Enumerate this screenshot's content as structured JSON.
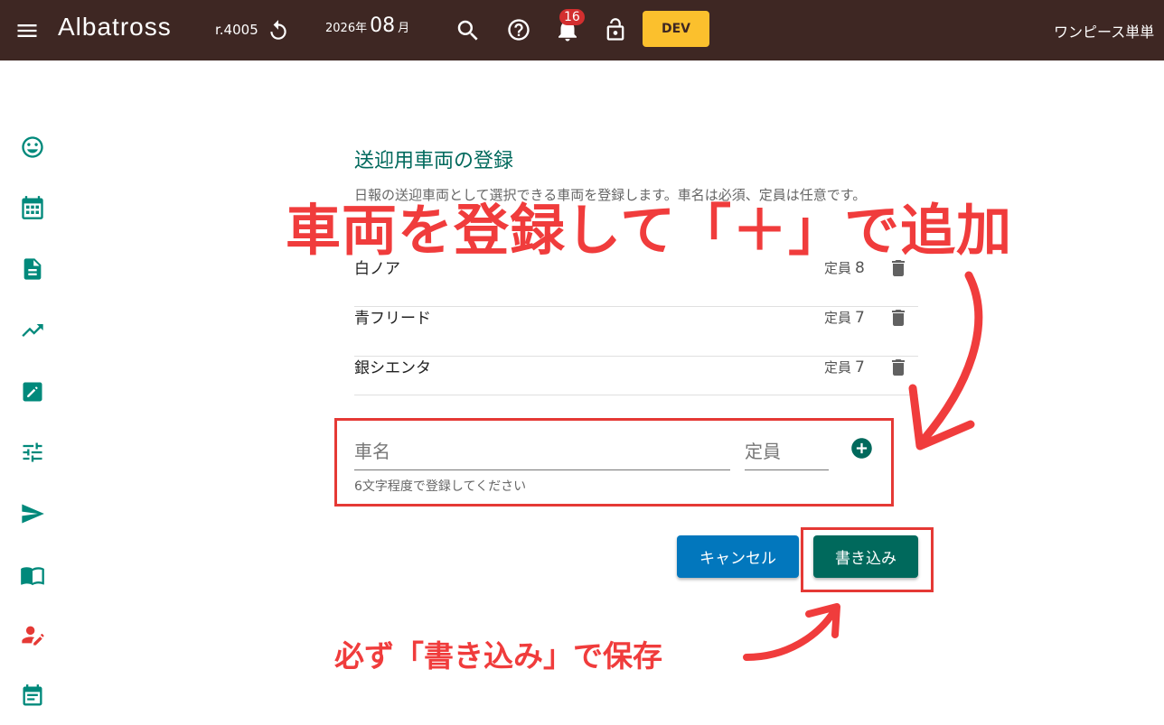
{
  "header": {
    "logo": "Albatross",
    "revision": "r.4005",
    "year": "2026年",
    "month": "08",
    "month_unit": "月",
    "notification_count": "16",
    "env_label": "DEV",
    "user_name": "ワンピース単単"
  },
  "page": {
    "title": "送迎用車両の登録",
    "description": "日報の送迎車両として選択できる車両を登録します。車名は必須、定員は任意です。"
  },
  "vehicles": [
    {
      "name": "白ノア",
      "capacity_label": "定員",
      "capacity": "8"
    },
    {
      "name": "青フリード",
      "capacity_label": "定員",
      "capacity": "7"
    },
    {
      "name": "銀シエンタ",
      "capacity_label": "定員",
      "capacity": "7"
    }
  ],
  "form": {
    "name_placeholder": "車名",
    "capacity_placeholder": "定員",
    "name_hint": "6文字程度で登録してください"
  },
  "actions": {
    "cancel_label": "キャンセル",
    "save_label": "書き込み"
  },
  "annotations": {
    "main": "車両を登録して「＋」で追加",
    "save_note": "必ず「書き込み」で保存"
  },
  "colors": {
    "header_bg": "#3e2723",
    "accent": "#00695c",
    "cancel": "#0277bd",
    "dev": "#fbc02d",
    "annotation": "#f03c3c"
  }
}
